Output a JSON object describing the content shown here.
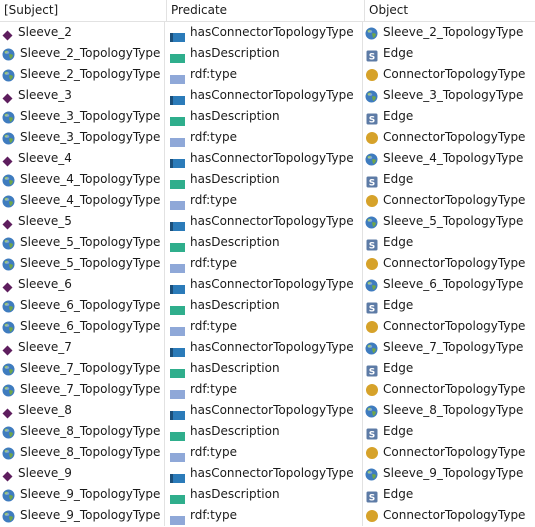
{
  "headers": {
    "subject": "[Subject]",
    "predicate": "Predicate",
    "object": "Object"
  },
  "colors": {
    "instance": "#5e1e5e",
    "globe_water": "#3f7cbf",
    "globe_land": "#6ea64c",
    "pred_connector": "#2b7bb9",
    "pred_description": "#2fae8c",
    "pred_type": "#8fa8d8",
    "literal": "#5d7ba6",
    "class": "#d6a22a"
  },
  "rows": [
    {
      "subject": "Sleeve_2",
      "subject_icon": "instance-icon",
      "predicate": "hasConnectorTopologyType",
      "predicate_icon": "object-property-icon",
      "object": "Sleeve_2_TopologyType",
      "object_icon": "globe-icon"
    },
    {
      "subject": "Sleeve_2_TopologyType",
      "subject_icon": "globe-icon",
      "predicate": "hasDescription",
      "predicate_icon": "data-property-icon",
      "object": "Edge",
      "object_icon": "string-literal-icon"
    },
    {
      "subject": "Sleeve_2_TopologyType",
      "subject_icon": "globe-icon",
      "predicate": "rdf:type",
      "predicate_icon": "rdf-type-icon",
      "object": "ConnectorTopologyType",
      "object_icon": "class-icon"
    },
    {
      "subject": "Sleeve_3",
      "subject_icon": "instance-icon",
      "predicate": "hasConnectorTopologyType",
      "predicate_icon": "object-property-icon",
      "object": "Sleeve_3_TopologyType",
      "object_icon": "globe-icon"
    },
    {
      "subject": "Sleeve_3_TopologyType",
      "subject_icon": "globe-icon",
      "predicate": "hasDescription",
      "predicate_icon": "data-property-icon",
      "object": "Edge",
      "object_icon": "string-literal-icon"
    },
    {
      "subject": "Sleeve_3_TopologyType",
      "subject_icon": "globe-icon",
      "predicate": "rdf:type",
      "predicate_icon": "rdf-type-icon",
      "object": "ConnectorTopologyType",
      "object_icon": "class-icon"
    },
    {
      "subject": "Sleeve_4",
      "subject_icon": "instance-icon",
      "predicate": "hasConnectorTopologyType",
      "predicate_icon": "object-property-icon",
      "object": "Sleeve_4_TopologyType",
      "object_icon": "globe-icon"
    },
    {
      "subject": "Sleeve_4_TopologyType",
      "subject_icon": "globe-icon",
      "predicate": "hasDescription",
      "predicate_icon": "data-property-icon",
      "object": "Edge",
      "object_icon": "string-literal-icon"
    },
    {
      "subject": "Sleeve_4_TopologyType",
      "subject_icon": "globe-icon",
      "predicate": "rdf:type",
      "predicate_icon": "rdf-type-icon",
      "object": "ConnectorTopologyType",
      "object_icon": "class-icon"
    },
    {
      "subject": "Sleeve_5",
      "subject_icon": "instance-icon",
      "predicate": "hasConnectorTopologyType",
      "predicate_icon": "object-property-icon",
      "object": "Sleeve_5_TopologyType",
      "object_icon": "globe-icon"
    },
    {
      "subject": "Sleeve_5_TopologyType",
      "subject_icon": "globe-icon",
      "predicate": "hasDescription",
      "predicate_icon": "data-property-icon",
      "object": "Edge",
      "object_icon": "string-literal-icon"
    },
    {
      "subject": "Sleeve_5_TopologyType",
      "subject_icon": "globe-icon",
      "predicate": "rdf:type",
      "predicate_icon": "rdf-type-icon",
      "object": "ConnectorTopologyType",
      "object_icon": "class-icon"
    },
    {
      "subject": "Sleeve_6",
      "subject_icon": "instance-icon",
      "predicate": "hasConnectorTopologyType",
      "predicate_icon": "object-property-icon",
      "object": "Sleeve_6_TopologyType",
      "object_icon": "globe-icon"
    },
    {
      "subject": "Sleeve_6_TopologyType",
      "subject_icon": "globe-icon",
      "predicate": "hasDescription",
      "predicate_icon": "data-property-icon",
      "object": "Edge",
      "object_icon": "string-literal-icon"
    },
    {
      "subject": "Sleeve_6_TopologyType",
      "subject_icon": "globe-icon",
      "predicate": "rdf:type",
      "predicate_icon": "rdf-type-icon",
      "object": "ConnectorTopologyType",
      "object_icon": "class-icon"
    },
    {
      "subject": "Sleeve_7",
      "subject_icon": "instance-icon",
      "predicate": "hasConnectorTopologyType",
      "predicate_icon": "object-property-icon",
      "object": "Sleeve_7_TopologyType",
      "object_icon": "globe-icon"
    },
    {
      "subject": "Sleeve_7_TopologyType",
      "subject_icon": "globe-icon",
      "predicate": "hasDescription",
      "predicate_icon": "data-property-icon",
      "object": "Edge",
      "object_icon": "string-literal-icon"
    },
    {
      "subject": "Sleeve_7_TopologyType",
      "subject_icon": "globe-icon",
      "predicate": "rdf:type",
      "predicate_icon": "rdf-type-icon",
      "object": "ConnectorTopologyType",
      "object_icon": "class-icon"
    },
    {
      "subject": "Sleeve_8",
      "subject_icon": "instance-icon",
      "predicate": "hasConnectorTopologyType",
      "predicate_icon": "object-property-icon",
      "object": "Sleeve_8_TopologyType",
      "object_icon": "globe-icon"
    },
    {
      "subject": "Sleeve_8_TopologyType",
      "subject_icon": "globe-icon",
      "predicate": "hasDescription",
      "predicate_icon": "data-property-icon",
      "object": "Edge",
      "object_icon": "string-literal-icon"
    },
    {
      "subject": "Sleeve_8_TopologyType",
      "subject_icon": "globe-icon",
      "predicate": "rdf:type",
      "predicate_icon": "rdf-type-icon",
      "object": "ConnectorTopologyType",
      "object_icon": "class-icon"
    },
    {
      "subject": "Sleeve_9",
      "subject_icon": "instance-icon",
      "predicate": "hasConnectorTopologyType",
      "predicate_icon": "object-property-icon",
      "object": "Sleeve_9_TopologyType",
      "object_icon": "globe-icon"
    },
    {
      "subject": "Sleeve_9_TopologyType",
      "subject_icon": "globe-icon",
      "predicate": "hasDescription",
      "predicate_icon": "data-property-icon",
      "object": "Edge",
      "object_icon": "string-literal-icon"
    },
    {
      "subject": "Sleeve_9_TopologyType",
      "subject_icon": "globe-icon",
      "predicate": "rdf:type",
      "predicate_icon": "rdf-type-icon",
      "object": "ConnectorTopologyType",
      "object_icon": "class-icon"
    }
  ]
}
